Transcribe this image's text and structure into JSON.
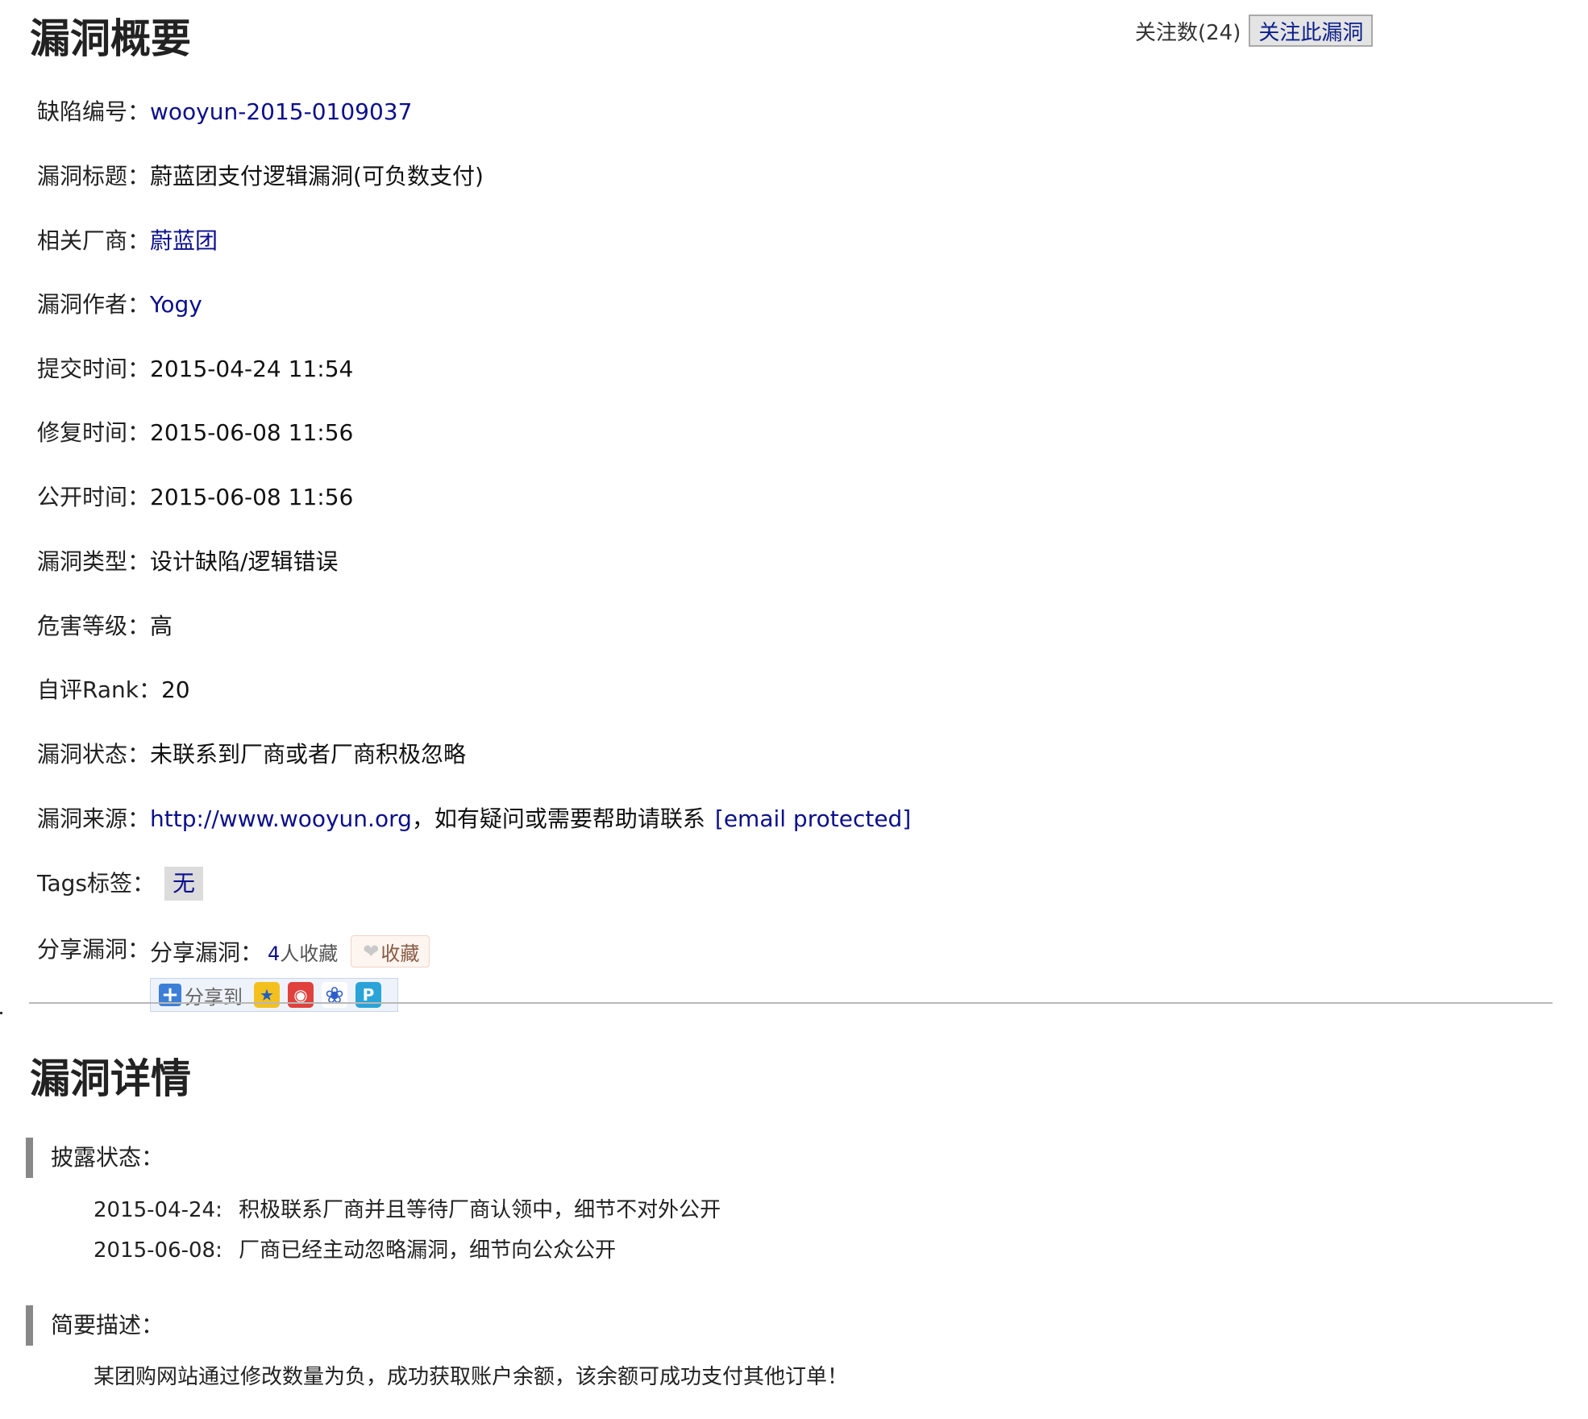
{
  "summary": {
    "title": "漏洞概要",
    "follow_count_label": "关注数(24)",
    "follow_button": "关注此漏洞",
    "fields": {
      "id_label": "缺陷编号：",
      "id_value": "wooyun-2015-0109037",
      "title_label": "漏洞标题：",
      "title_value": "蔚蓝团支付逻辑漏洞(可负数支付)",
      "vendor_label": "相关厂商：",
      "vendor_value": "蔚蓝团",
      "author_label": "漏洞作者：",
      "author_value": "Yogy",
      "submit_label": "提交时间：",
      "submit_value": "2015-04-24 11:54",
      "fix_label": "修复时间：",
      "fix_value": "2015-06-08 11:56",
      "public_label": "公开时间：",
      "public_value": "2015-06-08 11:56",
      "type_label": "漏洞类型：",
      "type_value": "设计缺陷/逻辑错误",
      "level_label": "危害等级：",
      "level_value": "高",
      "rank_label": "自评Rank：",
      "rank_value": "20",
      "status_label": "漏洞状态：",
      "status_value": "未联系到厂商或者厂商积极忽略",
      "source_label": "漏洞来源：",
      "source_link": "http://www.wooyun.org",
      "source_text": "，如有疑问或需要帮助请联系",
      "source_email": "[email protected]",
      "tags_label": "Tags标签：",
      "tags_value": "无",
      "share_label": "分享漏洞："
    },
    "share": {
      "inline_label": "分享漏洞：",
      "fav_count_num": "4",
      "fav_count_text": "人收藏",
      "fav_button": "收藏",
      "share_to": "分享到",
      "icons": [
        "qzone-icon",
        "weibo-icon",
        "baidu-icon",
        "pp-icon"
      ]
    }
  },
  "details": {
    "title": "漏洞详情",
    "disclosure_label": "披露状态：",
    "disclosure": [
      {
        "date": "2015-04-24:",
        "text": "积极联系厂商并且等待厂商认领中，细节不对外公开"
      },
      {
        "date": "2015-06-08:",
        "text": "厂商已经主动忽略漏洞，细节向公众公开"
      }
    ],
    "brief_label": "简要描述：",
    "brief_text": "某团购网站通过修改数量为负，成功获取账户余额，该余额可成功支付其他订单！"
  },
  "colors": {
    "link": "#0b0f8c",
    "divider": "#b8b8b8",
    "tag_bg": "#dcdcdc"
  }
}
